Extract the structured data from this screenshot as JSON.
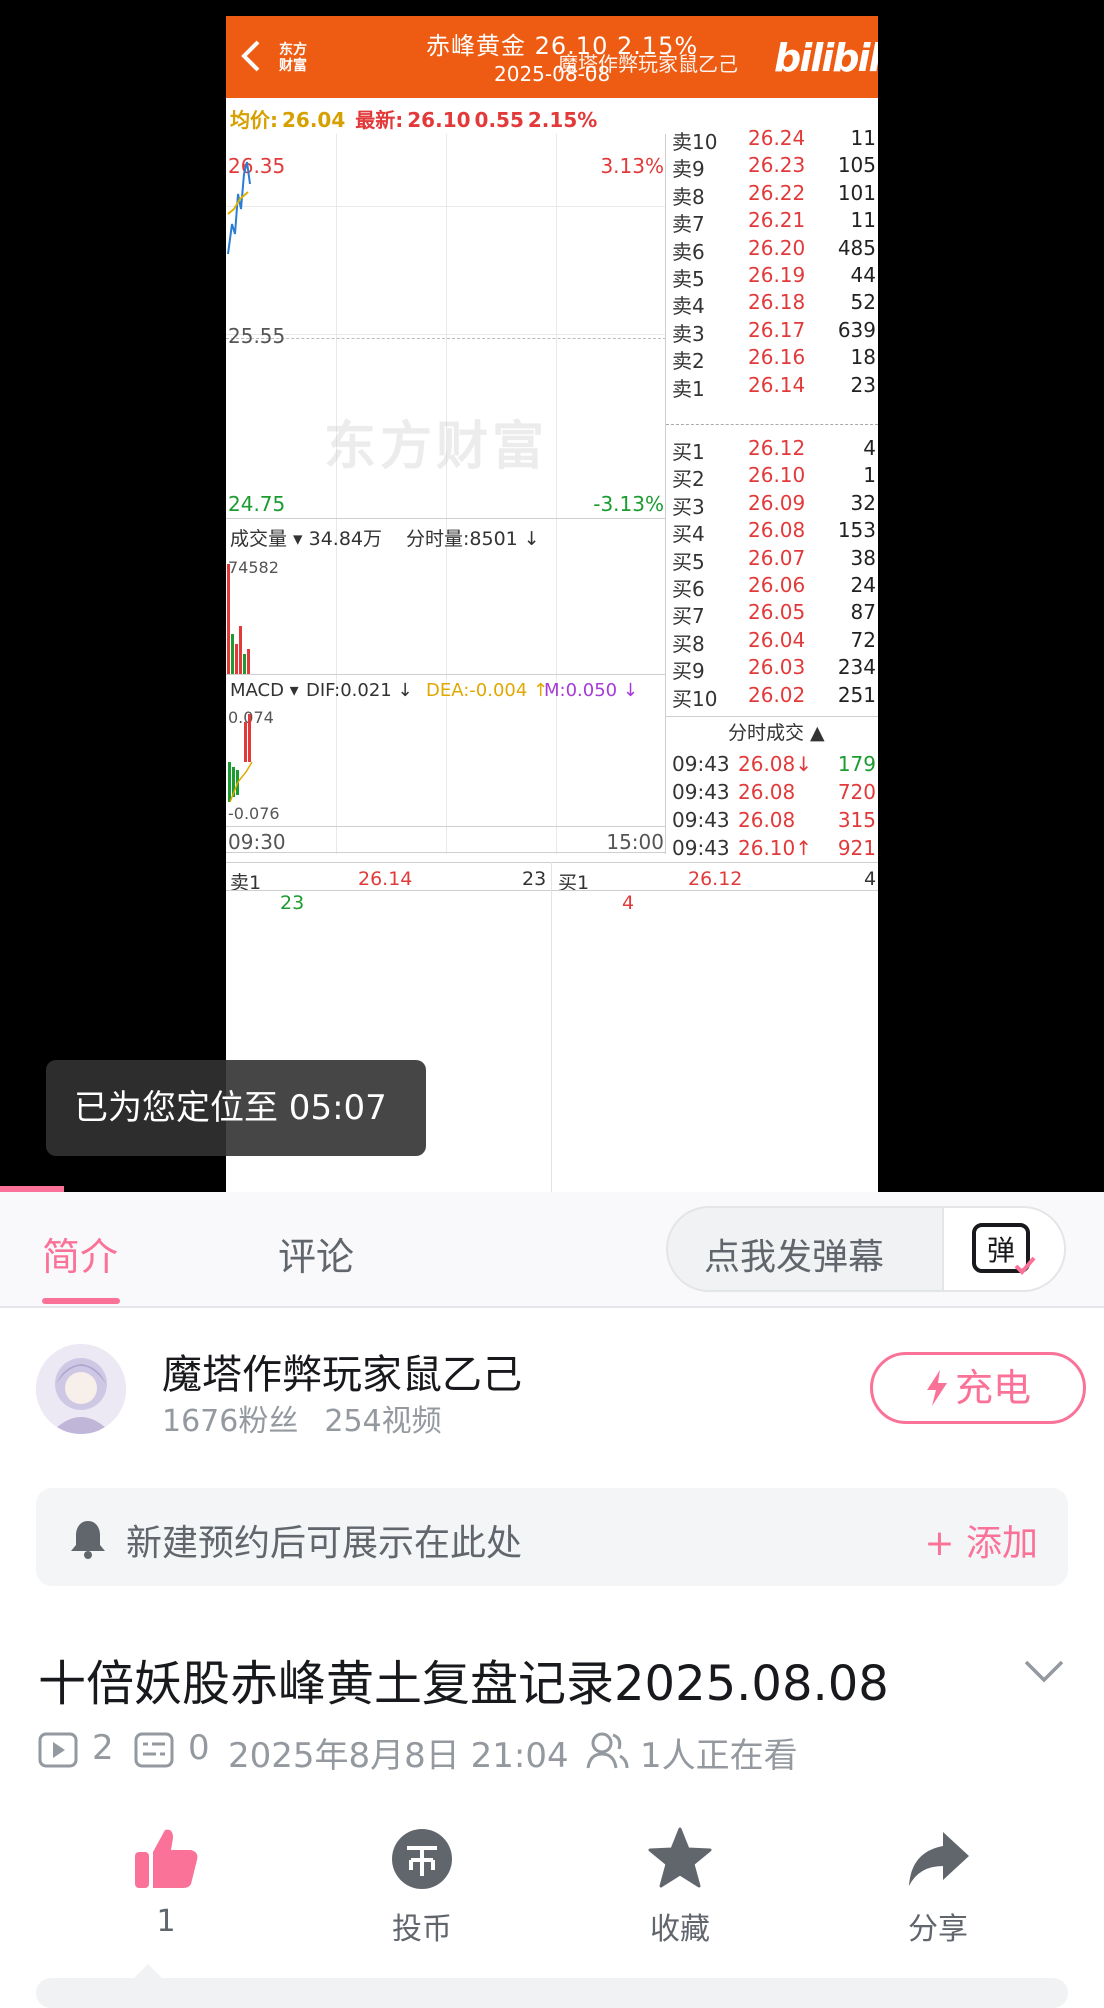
{
  "player": {
    "frame": {
      "logo": "东方\n财富",
      "title": "赤峰黄金  26.10  2.15%",
      "date": "2025-08-08",
      "uploader_watermark": "魔塔作弊玩家鼠乙己",
      "bili_logo": "bilibili",
      "quote": {
        "avg_label": "均价:",
        "avg_value": "26.04",
        "latest_label": "最新:",
        "latest_price": "26.10",
        "change": "0.55",
        "change_pct": "2.15%"
      },
      "chart": {
        "price_high": "26.35",
        "pct_high": "3.13%",
        "price_mid": "25.55",
        "watermark": "东方财富",
        "price_low": "24.75",
        "pct_low": "-3.13%",
        "volume_label": "成交量 ▾ 34.84万",
        "volume_detail": "分时量:8501 ↓",
        "volume_max": "74582",
        "macd_label": "MACD ▾",
        "dif": "DIF:0.021 ↓",
        "dea": "DEA:-0.004 ↑",
        "m": "M:0.050 ↓",
        "macd_high": "0.074",
        "macd_low": "-0.076",
        "time_start": "09:30",
        "time_end": "15:00"
      },
      "asks": [
        {
          "label": "卖10",
          "price": "26.24",
          "volume": "11"
        },
        {
          "label": "卖9",
          "price": "26.23",
          "volume": "105"
        },
        {
          "label": "卖8",
          "price": "26.22",
          "volume": "101"
        },
        {
          "label": "卖7",
          "price": "26.21",
          "volume": "11"
        },
        {
          "label": "卖6",
          "price": "26.20",
          "volume": "485"
        },
        {
          "label": "卖5",
          "price": "26.19",
          "volume": "44"
        },
        {
          "label": "卖4",
          "price": "26.18",
          "volume": "52"
        },
        {
          "label": "卖3",
          "price": "26.17",
          "volume": "639"
        },
        {
          "label": "卖2",
          "price": "26.16",
          "volume": "18"
        },
        {
          "label": "卖1",
          "price": "26.14",
          "volume": "23"
        }
      ],
      "bids": [
        {
          "label": "买1",
          "price": "26.12",
          "volume": "4"
        },
        {
          "label": "买2",
          "price": "26.10",
          "volume": "1"
        },
        {
          "label": "买3",
          "price": "26.09",
          "volume": "32"
        },
        {
          "label": "买4",
          "price": "26.08",
          "volume": "153"
        },
        {
          "label": "买5",
          "price": "26.07",
          "volume": "38"
        },
        {
          "label": "买6",
          "price": "26.06",
          "volume": "24"
        },
        {
          "label": "买7",
          "price": "26.05",
          "volume": "87"
        },
        {
          "label": "买8",
          "price": "26.04",
          "volume": "72"
        },
        {
          "label": "买9",
          "price": "26.03",
          "volume": "234"
        },
        {
          "label": "买10",
          "price": "26.02",
          "volume": "251"
        }
      ],
      "trades_header": "分时成交 ▲",
      "trades": [
        {
          "time": "09:43",
          "price": "26.08↓",
          "volume": "179",
          "color": "#1a9c2f"
        },
        {
          "time": "09:43",
          "price": "26.08",
          "volume": "720",
          "color": "#e23a3a"
        },
        {
          "time": "09:43",
          "price": "26.08",
          "volume": "315",
          "color": "#e23a3a"
        },
        {
          "time": "09:43",
          "price": "26.10↑",
          "volume": "921",
          "color": "#e23a3a"
        }
      ],
      "bottom_row": {
        "ask_label": "卖1",
        "ask_price": "26.14",
        "ask_volume": "23",
        "bid_label": "买1",
        "bid_price": "26.12",
        "bid_volume": "4",
        "ask_count": "23",
        "bid_count": "4"
      }
    },
    "toast": "已为您定位至 05:07",
    "progress_fraction": 0.058
  },
  "tabs": {
    "intro": "简介",
    "comments": "评论",
    "danmaku_placeholder": "点我发弹幕",
    "danmaku_icon_text": "弹"
  },
  "uploader": {
    "name": "魔塔作弊玩家鼠乙己",
    "fans": "1676粉丝",
    "videos": "254视频",
    "charge_label": "充电"
  },
  "reservation": {
    "text": "新建预约后可展示在此处",
    "add_label": "+ 添加"
  },
  "video": {
    "title": "十倍妖股赤峰黄土复盘记录2025.08.08",
    "plays": "2",
    "danmaku_count": "0",
    "publish_time": "2025年8月8日 21:04",
    "watching": "1人正在看"
  },
  "actions": {
    "like": "1",
    "coin": "投币",
    "favorite": "收藏",
    "share": "分享"
  },
  "colors": {
    "accent": "#fb7299",
    "header_orange": "#ee5b12",
    "up_red": "#e23a3a",
    "down_green": "#1a9c2f"
  }
}
